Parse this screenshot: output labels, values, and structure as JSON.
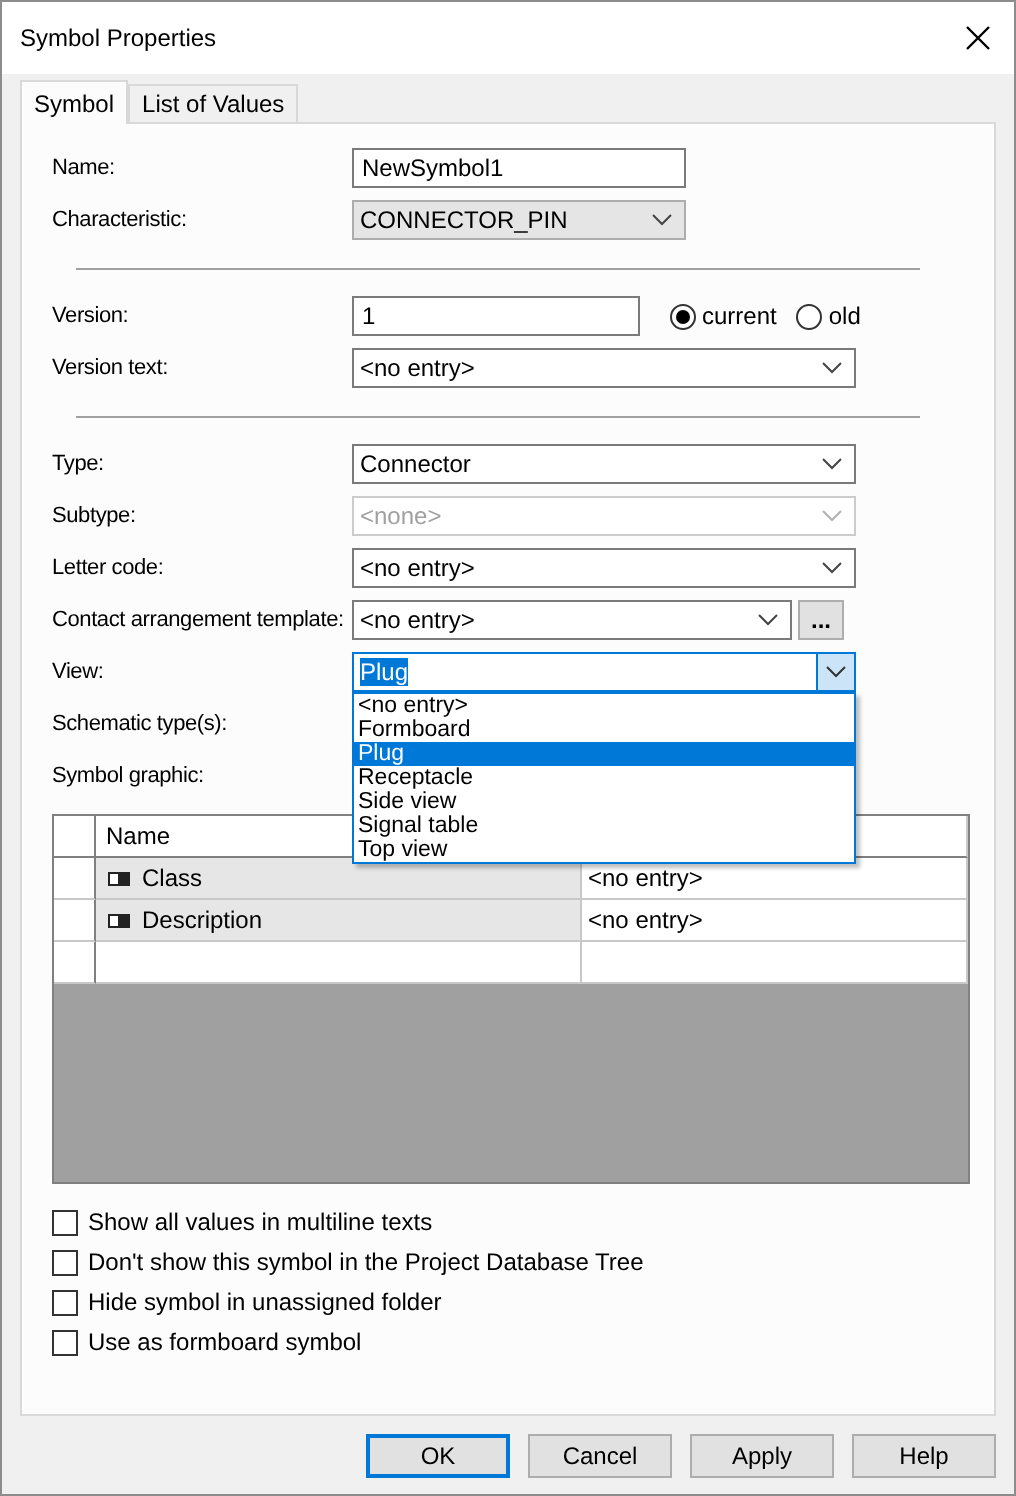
{
  "window": {
    "title": "Symbol Properties"
  },
  "tabs": [
    {
      "label": "Symbol",
      "selected": true
    },
    {
      "label": "List of Values",
      "selected": false
    }
  ],
  "fields": [
    {
      "kind": "text",
      "label": "Name:",
      "value": "NewSymbol1"
    },
    {
      "kind": "list",
      "label": "Characteristic:",
      "value": "CONNECTOR_PIN"
    },
    {
      "kind": "rule"
    },
    {
      "kind": "version",
      "label": "Version:",
      "value": "1",
      "options": [
        {
          "label": "current",
          "selected": true
        },
        {
          "label": "old",
          "selected": false
        }
      ]
    },
    {
      "kind": "combo",
      "label": "Version text:",
      "value": "<no entry>",
      "disabled": false
    },
    {
      "kind": "rule"
    },
    {
      "kind": "combo",
      "label": "Type:",
      "value": "Connector",
      "disabled": false
    },
    {
      "kind": "combo",
      "label": "Subtype:",
      "value": "<none>",
      "disabled": true
    },
    {
      "kind": "combo",
      "label": "Letter code:",
      "value": "<no entry>",
      "disabled": false
    },
    {
      "kind": "combo",
      "label": "Contact arrangement template:",
      "value": "<no entry>",
      "disabled": false,
      "browse": "..."
    },
    {
      "kind": "combo",
      "label": "View:",
      "value": "Plug",
      "disabled": false,
      "open": true,
      "options": [
        {
          "label": "<no entry>",
          "selected": false
        },
        {
          "label": "Formboard",
          "selected": false
        },
        {
          "label": "Plug",
          "selected": true
        },
        {
          "label": "Receptacle",
          "selected": false
        },
        {
          "label": "Side view",
          "selected": false
        },
        {
          "label": "Signal table",
          "selected": false
        },
        {
          "label": "Top view",
          "selected": false
        }
      ]
    },
    {
      "kind": "label",
      "label": "Schematic type(s):"
    },
    {
      "kind": "label",
      "label": "Symbol graphic:"
    }
  ],
  "grid": {
    "columns": [
      "Name"
    ],
    "rows": [
      {
        "name": "Class",
        "value": "<no entry>"
      },
      {
        "name": "Description",
        "value": "<no entry>"
      }
    ]
  },
  "checks": [
    {
      "label": "Show all values in multiline texts",
      "checked": false
    },
    {
      "label": "Don't show this symbol in the Project Database Tree",
      "checked": false
    },
    {
      "label": "Hide symbol in unassigned folder",
      "checked": false
    },
    {
      "label": "Use as formboard symbol",
      "checked": false
    }
  ],
  "buttons": [
    {
      "label": "OK",
      "default": true
    },
    {
      "label": "Cancel",
      "default": false
    },
    {
      "label": "Apply",
      "default": false
    },
    {
      "label": "Help",
      "default": false
    }
  ]
}
